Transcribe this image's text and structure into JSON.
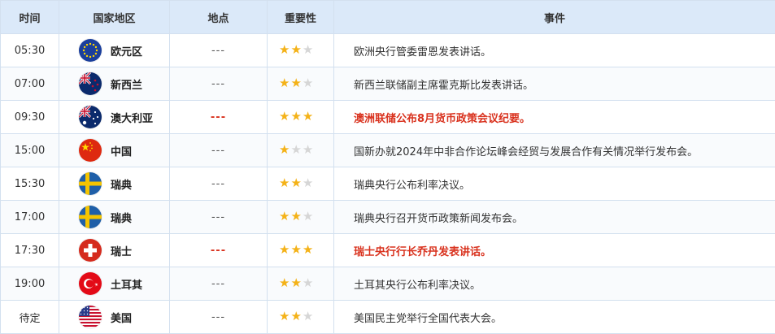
{
  "header": {
    "time": "时间",
    "country": "国家地区",
    "place": "地点",
    "importance": "重要性",
    "event": "事件"
  },
  "colors": {
    "highlight": "#d9321e",
    "star_on": "#f4b218",
    "star_off": "#d6d6d6",
    "header_bg": "#dbe9f9"
  },
  "rows": [
    {
      "time": "05:30",
      "country": "欧元区",
      "flag": "eu-flag-icon",
      "place": "---",
      "stars": 2,
      "event": "欧洲央行管委雷恩发表讲话。",
      "highlight": false
    },
    {
      "time": "07:00",
      "country": "新西兰",
      "flag": "nz-flag-icon",
      "place": "---",
      "stars": 2,
      "event": "新西兰联储副主席霍克斯比发表讲话。",
      "highlight": false
    },
    {
      "time": "09:30",
      "country": "澳大利亚",
      "flag": "au-flag-icon",
      "place": "---",
      "stars": 3,
      "event": "澳洲联储公布8月货币政策会议纪要。",
      "highlight": true
    },
    {
      "time": "15:00",
      "country": "中国",
      "flag": "cn-flag-icon",
      "place": "---",
      "stars": 1,
      "event": "国新办就2024年中非合作论坛峰会经贸与发展合作有关情况举行发布会。",
      "highlight": false
    },
    {
      "time": "15:30",
      "country": "瑞典",
      "flag": "se-flag-icon",
      "place": "---",
      "stars": 2,
      "event": "瑞典央行公布利率决议。",
      "highlight": false
    },
    {
      "time": "17:00",
      "country": "瑞典",
      "flag": "se-flag-icon",
      "place": "---",
      "stars": 2,
      "event": "瑞典央行召开货币政策新闻发布会。",
      "highlight": false
    },
    {
      "time": "17:30",
      "country": "瑞士",
      "flag": "ch-flag-icon",
      "place": "---",
      "stars": 3,
      "event": "瑞士央行行长乔丹发表讲话。",
      "highlight": true
    },
    {
      "time": "19:00",
      "country": "土耳其",
      "flag": "tr-flag-icon",
      "place": "---",
      "stars": 2,
      "event": "土耳其央行公布利率决议。",
      "highlight": false
    },
    {
      "time": "待定",
      "country": "美国",
      "flag": "us-flag-icon",
      "place": "---",
      "stars": 2,
      "event": "美国民主党举行全国代表大会。",
      "highlight": false
    }
  ]
}
